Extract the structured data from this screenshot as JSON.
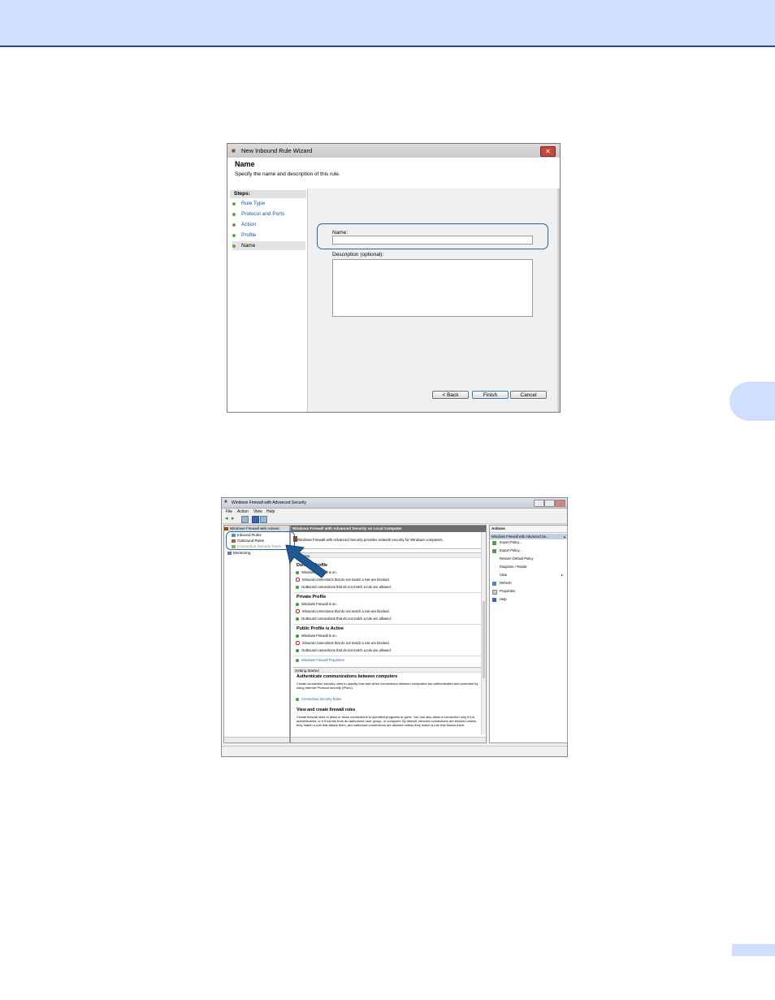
{
  "wizard": {
    "title": "New Inbound Rule Wizard",
    "heading": "Name",
    "subtitle": "Specify the name and description of this rule.",
    "steps_label": "Steps:",
    "steps": [
      "Rule Type",
      "Protocol and Ports",
      "Action",
      "Profile",
      "Name"
    ],
    "selected_step": "Name",
    "name_label": "Name:",
    "name_value": "",
    "description_label": "Description (optional):",
    "description_value": "",
    "back_button": "< Back",
    "finish_button": "Finish",
    "cancel_button": "Cancel",
    "close_glyph": "✕"
  },
  "firewall": {
    "title": "Windows Firewall with Advanced Security",
    "menu": [
      "File",
      "Action",
      "View",
      "Help"
    ],
    "tree": {
      "root": "Windows Firewall with Advanc",
      "items": [
        "Inbound Rules",
        "Outbound Rules",
        "Connection Security Rules",
        "Monitoring"
      ]
    },
    "center_header": "Windows Firewall with Advanced Security on Local Computer",
    "intro": "Windows Firewall with Advanced Security provides network security for Windows computers.",
    "overview": "Overview",
    "profiles": [
      {
        "title": "Domain Profile",
        "lines": [
          "Windows Firewall is on.",
          "Inbound connections that do not match a rule are blocked.",
          "Outbound connections that do not match a rule are allowed."
        ]
      },
      {
        "title": "Private Profile",
        "lines": [
          "Windows Firewall is on.",
          "Inbound connections that do not match a rule are blocked.",
          "Outbound connections that do not match a rule are allowed."
        ]
      },
      {
        "title": "Public Profile is Active",
        "lines": [
          "Windows Firewall is on.",
          "Inbound connections that do not match a rule are blocked.",
          "Outbound connections that do not match a rule are allowed."
        ]
      }
    ],
    "properties_link": "Windows Firewall Properties",
    "getting_started": "Getting Started",
    "auth_title": "Authenticate communications between computers",
    "auth_body": "Create connection security rules to specify how and when connections between computers are authenticated and protected by using Internet Protocol security (IPsec).",
    "auth_link": "Connection Security Rules",
    "fw_rules_title": "View and create firewall rules",
    "fw_rules_body": "Create firewall rules to allow or block connections to specified programs or ports. You can also allow a connection only if it is authenticated, or if it comes from an authorized user, group, or computer. By default, inbound connections are blocked unless they match a rule that allows them, and outbound connections are allowed unless they match a rule that blocks them.",
    "actions_header": "Actions",
    "actions_sub": "Windows Firewall with Advanced Se...",
    "actions": [
      "Import Policy...",
      "Export Policy...",
      "Restore Default Policy",
      "Diagnose / Repair",
      "View",
      "Refresh",
      "Properties",
      "Help"
    ],
    "submenu_arrow": "▸",
    "collapse_glyph": "▴"
  }
}
